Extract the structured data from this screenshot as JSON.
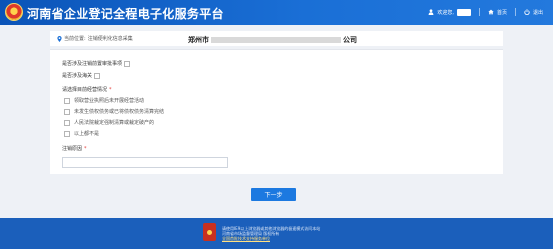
{
  "header": {
    "title": "河南省企业登记全程电子化服务平台",
    "welcome": "欢迎您,",
    "home": "首页",
    "logout": "退出"
  },
  "breadcrumb": {
    "label": "当前位置:",
    "link": "注销便利化信息采集",
    "company_prefix": "郑州市",
    "company_suffix": "公司"
  },
  "form": {
    "q1": "是否涉及注销前置审批事项",
    "q2": "是否涉及海关",
    "q3": "请选择目前经营情况",
    "q3_required_mark": "*",
    "options": [
      "领取营业执照后未开展经营活动",
      "未发生债权债务或已将债权债务清算完结",
      "人民法院裁定强制清算或裁定破产的",
      "以上都不是"
    ],
    "reason_label": "注销原因",
    "reason_required_mark": "*",
    "reason_value": ""
  },
  "actions": {
    "next": "下一步"
  },
  "footer": {
    "line1": "请使用IE9以上浏览器或其他浏览器的极速模式访问本站",
    "line2": "河南省市场监督管理局 版权所有",
    "link": "全国首批技术支持服务单位"
  }
}
